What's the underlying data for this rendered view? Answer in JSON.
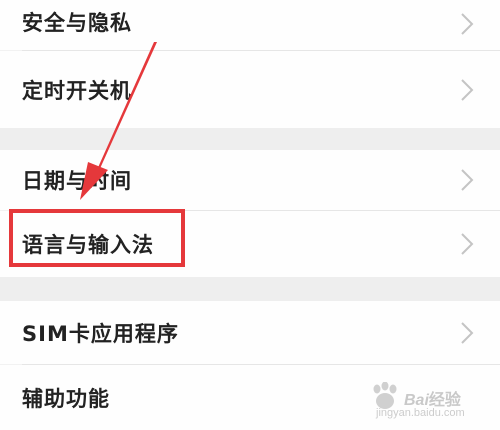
{
  "settings": {
    "items": [
      {
        "label": "安全与隐私"
      },
      {
        "label": "定时开关机"
      },
      {
        "label": "日期与时间"
      },
      {
        "label": "语言与输入法"
      },
      {
        "label": "SIM卡应用程序"
      },
      {
        "label": "辅助功能"
      }
    ]
  },
  "watermark": {
    "brand": "Bai",
    "brand_cn": "经验",
    "url": "jingyan.baidu.com"
  },
  "colors": {
    "highlight": "#e5383b",
    "background": "#f2f2f2",
    "row": "#fefefe"
  }
}
